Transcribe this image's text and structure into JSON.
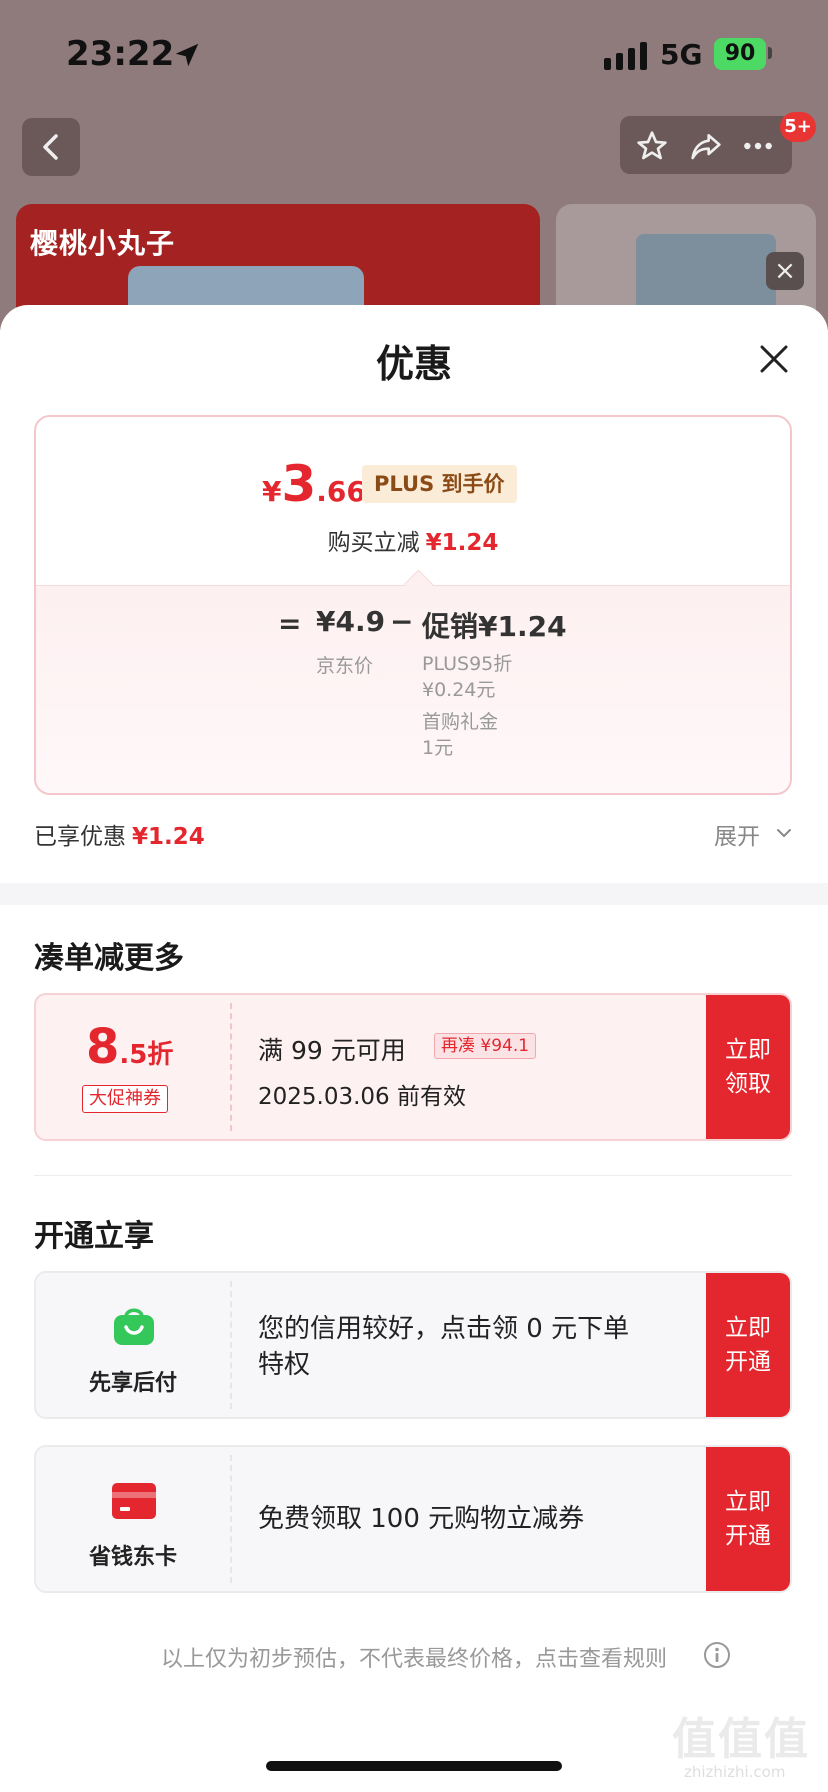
{
  "status_bar": {
    "time": "23:22",
    "network": "5G",
    "battery": "90"
  },
  "background": {
    "brand_logo": "樱桃小丸子",
    "badge": "5+",
    "banner_close": "×",
    "actions": [
      "star-icon",
      "share-icon",
      "more-icon"
    ]
  },
  "sheet": {
    "title": "优惠",
    "price": {
      "currency": "¥",
      "integer": "3",
      "decimal": ".66",
      "plus_label": "PLUS 到手价",
      "instant_label": "购买立减",
      "instant_value": "¥1.24"
    },
    "breakdown": {
      "equals": "=",
      "jd_price": "¥4.9",
      "jd_label": "京东价",
      "minus": "−",
      "promo": "促销¥1.24",
      "items": [
        {
          "line1": "PLUS95折",
          "line2": "¥0.24元"
        },
        {
          "line1": "首购礼金",
          "line2": "1元"
        }
      ]
    },
    "enjoyed": {
      "label": "已享优惠",
      "value": "¥1.24",
      "expand": "展开"
    },
    "combine": {
      "title": "凑单减更多",
      "coupon": {
        "discount_num": "8",
        "discount_unit": ".5折",
        "tag": "大促神券",
        "condition": "满 99 元可用",
        "add_more": "再凑 ¥94.1",
        "expiry": "2025.03.06 前有效",
        "cta": "立即\n领取"
      }
    },
    "activate": {
      "title": "开通立享",
      "services": [
        {
          "icon": "shopping-bag-icon",
          "name": "先享后付",
          "desc_line1": "您的信用较好，点击领 0 元下单",
          "desc_line2": "特权",
          "cta": "立即\n开通"
        },
        {
          "icon": "card-icon",
          "name": "省钱东卡",
          "desc_line1": "免费领取 100 元购物立减券",
          "cta": "立即\n开通"
        }
      ]
    },
    "footer": "以上仅为初步预估，不代表最终价格，点击查看规则",
    "watermark": "值值值",
    "watermark_sub": "zhizhizhi.com"
  },
  "colors": {
    "accent": "#e4272e",
    "plus_bg": "#fbecd8",
    "success": "#34c759"
  }
}
